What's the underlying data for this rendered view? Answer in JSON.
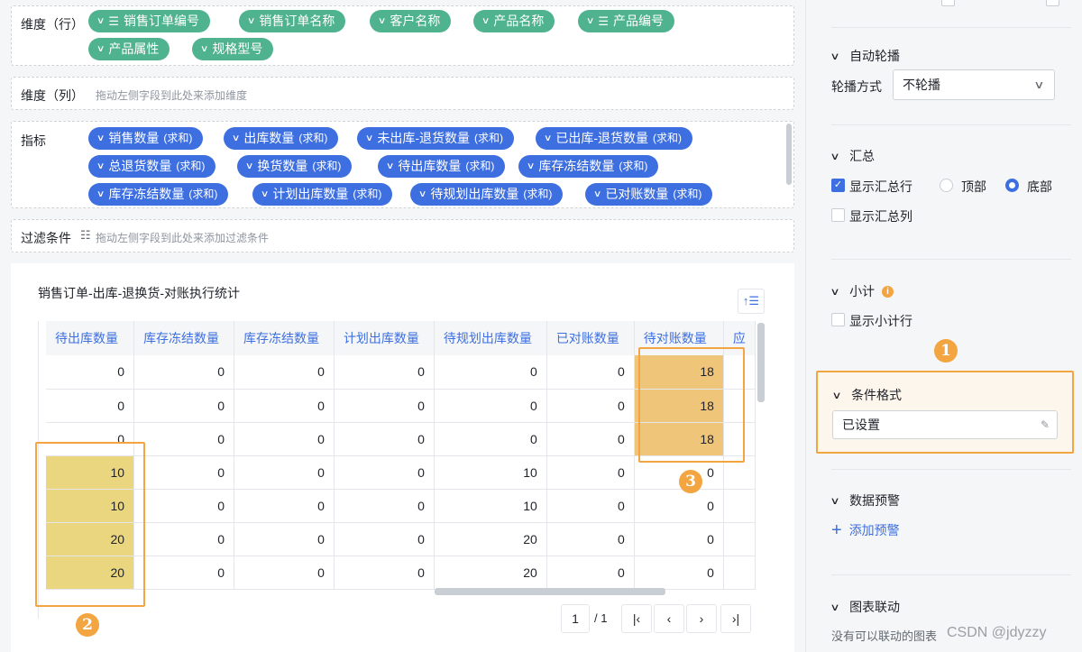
{
  "rows_zone": {
    "label": "维度（行）",
    "fields": [
      "销售订单编号",
      "销售订单名称",
      "客户名称",
      "产品名称",
      "产品编号",
      "产品属性",
      "规格型号"
    ]
  },
  "cols_zone": {
    "label": "维度（列）",
    "hint": "拖动左侧字段到此处来添加维度"
  },
  "metrics_zone": {
    "label": "指标",
    "suffix": "(求和)",
    "fields": [
      "销售数量",
      "出库数量",
      "未出库-退货数量",
      "已出库-退货数量",
      "总退货数量",
      "换货数量",
      "待出库数量",
      "库存冻结数量",
      "库存冻结数量",
      "计划出库数量",
      "待规划出库数量",
      "已对账数量"
    ]
  },
  "filter_zone": {
    "label": "过滤条件",
    "hint": "拖动左侧字段到此处来添加过滤条件"
  },
  "chart": {
    "title": "销售订单-出库-退换货-对账执行统计",
    "columns": [
      "待出库数量",
      "库存冻结数量",
      "库存冻结数量",
      "计划出库数量",
      "待规划出库数量",
      "已对账数量",
      "待对账数量",
      "应"
    ],
    "rows": [
      [
        "0",
        "0",
        "0",
        "0",
        "0",
        "0",
        "18"
      ],
      [
        "0",
        "0",
        "0",
        "0",
        "0",
        "0",
        "18"
      ],
      [
        "0",
        "0",
        "0",
        "0",
        "0",
        "0",
        "18"
      ],
      [
        "10",
        "0",
        "0",
        "0",
        "10",
        "0",
        "0"
      ],
      [
        "10",
        "0",
        "0",
        "0",
        "10",
        "0",
        "0"
      ],
      [
        "20",
        "0",
        "0",
        "0",
        "20",
        "0",
        "0"
      ],
      [
        "20",
        "0",
        "0",
        "0",
        "20",
        "0",
        "0"
      ]
    ]
  },
  "pager": {
    "page": "1",
    "total": "/ 1"
  },
  "annotations": {
    "n1": "1",
    "n2": "2",
    "n3": "3"
  },
  "panel": {
    "carousel": {
      "title": "自动轮播",
      "mode_label": "轮播方式",
      "mode_value": "不轮播"
    },
    "summary": {
      "title": "汇总",
      "show_total_row": "显示汇总行",
      "top": "顶部",
      "bottom": "底部",
      "show_total_col": "显示汇总列"
    },
    "subtotal": {
      "title": "小计",
      "show_subtotal_row": "显示小计行"
    },
    "conditional": {
      "title": "条件格式",
      "value": "已设置"
    },
    "alert": {
      "title": "数据预警",
      "add": "添加预警"
    },
    "linkage": {
      "title": "图表联动",
      "empty": "没有可以联动的图表"
    }
  },
  "watermark": "CSDN @jdyzzy",
  "colors": {
    "accent": "#3d6fe0",
    "green": "#4fb38f",
    "highlight": "#f2a541"
  }
}
